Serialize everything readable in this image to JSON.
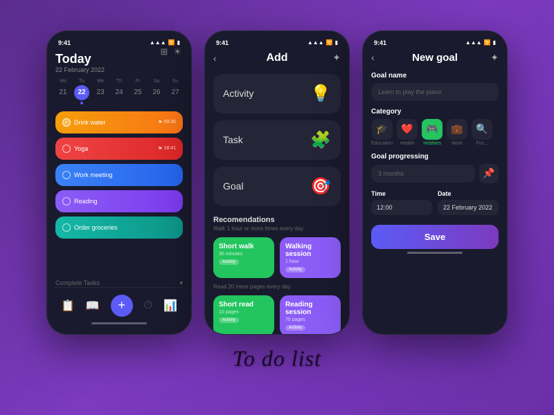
{
  "app": {
    "title": "To do list"
  },
  "phone1": {
    "status_time": "9:41",
    "header_title": "Today",
    "header_date": "22 February 2022",
    "calendar": {
      "days": [
        {
          "name": "Mo",
          "num": "21",
          "active": false,
          "dot": false
        },
        {
          "name": "Tu",
          "num": "22",
          "active": true,
          "dot": true
        },
        {
          "name": "We",
          "num": "23",
          "active": false,
          "dot": false
        },
        {
          "name": "Th",
          "num": "24",
          "active": false,
          "dot": false
        },
        {
          "name": "Fr",
          "num": "25",
          "active": false,
          "dot": false
        },
        {
          "name": "Sa",
          "num": "26",
          "active": false,
          "dot": false
        },
        {
          "name": "Su",
          "num": "27",
          "active": false,
          "dot": false
        }
      ]
    },
    "tasks": [
      {
        "label": "Drink water",
        "color": "orange",
        "checked": true,
        "meta": "09:30"
      },
      {
        "label": "Yoga",
        "color": "red",
        "checked": false,
        "meta": "18:41"
      },
      {
        "label": "Work meeting",
        "color": "blue",
        "checked": false,
        "meta": ""
      },
      {
        "label": "Reading",
        "color": "purple",
        "checked": false,
        "meta": ""
      },
      {
        "label": "Order groceries",
        "color": "teal",
        "checked": false,
        "meta": ""
      }
    ],
    "complete_tasks_label": "Complete Tasks",
    "nav": {
      "items": [
        "clipboard",
        "book",
        "add",
        "clock",
        "chart"
      ]
    }
  },
  "phone2": {
    "status_time": "9:41",
    "header_title": "Add",
    "options": [
      {
        "label": "Activity",
        "icon": "💡"
      },
      {
        "label": "Task",
        "icon": "🧩"
      },
      {
        "label": "Goal",
        "icon": "🎯"
      }
    ],
    "recommendations": {
      "title": "Recomendations",
      "subtitle": "Walk 1 hour or more times every day",
      "cards_row1": [
        {
          "title": "Short walk",
          "sub": "30 minutes",
          "tag": "Activity",
          "color": "green"
        },
        {
          "title": "Walking session",
          "sub": "1 hour",
          "tag": "Activity",
          "color": "purple-card"
        }
      ],
      "subtitle2": "Read 20 more pages every day",
      "cards_row2": [
        {
          "title": "Short read",
          "sub": "10 pages",
          "tag": "Activity",
          "color": "green"
        },
        {
          "title": "Reading session",
          "sub": "70 pages",
          "tag": "Activity",
          "color": "purple-card"
        }
      ]
    }
  },
  "phone3": {
    "status_time": "9:41",
    "header_title": "New goal",
    "form": {
      "goal_name_label": "Goal name",
      "goal_name_placeholder": "Learn to play the piano",
      "category_label": "Category",
      "categories": [
        {
          "label": "Education",
          "icon": "🎓",
          "active": false
        },
        {
          "label": "Health",
          "icon": "❤️",
          "active": false
        },
        {
          "label": "Hobbies",
          "icon": "🎮",
          "active": true
        },
        {
          "label": "Work",
          "icon": "💼",
          "active": false
        },
        {
          "label": "Focus",
          "icon": "🔍",
          "active": false
        }
      ],
      "goal_progressing_label": "Goal progressing",
      "goal_progressing_value": "3 months",
      "time_label": "Time",
      "time_value": "12:00",
      "date_label": "Date",
      "date_value": "22 February 2022",
      "save_label": "Save"
    }
  }
}
